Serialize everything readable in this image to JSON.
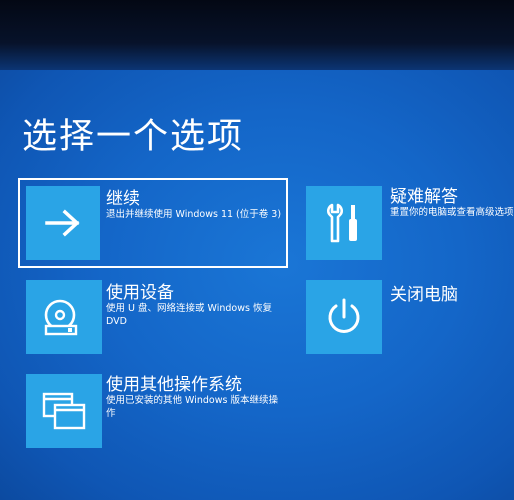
{
  "page": {
    "title": "选择一个选项"
  },
  "options": {
    "continue": {
      "title": "继续",
      "description": "退出并继续使用 Windows 11 (位于卷 3)",
      "icon": "arrow-right-icon"
    },
    "troubleshoot": {
      "title": "疑难解答",
      "description": "重置你的电脑或查看高级选项",
      "icon": "tools-icon"
    },
    "use_device": {
      "title": "使用设备",
      "description": "使用 U 盘、网络连接或 Windows 恢复 DVD",
      "icon": "disc-drive-icon"
    },
    "turn_off": {
      "title": "关闭电脑",
      "description": "",
      "icon": "power-icon"
    },
    "other_os": {
      "title": "使用其他操作系统",
      "description": "使用已安装的其他 Windows 版本继续操作",
      "icon": "windows-stack-icon"
    }
  },
  "colors": {
    "background": "#1466c8",
    "tile": "#2aa4e6",
    "text": "#ffffff"
  }
}
